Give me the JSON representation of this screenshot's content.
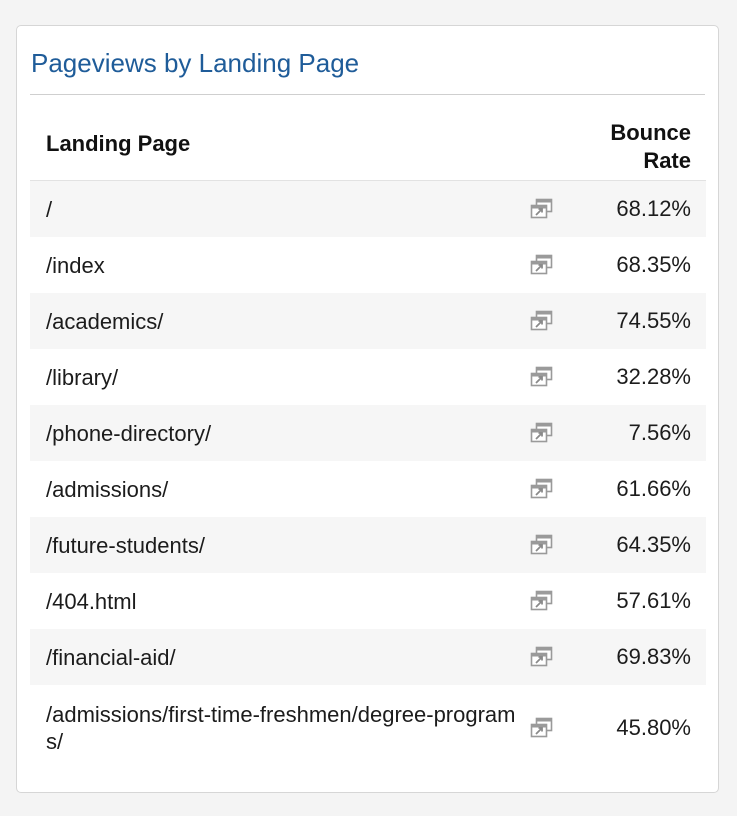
{
  "panel": {
    "title": "Pageviews by Landing Page"
  },
  "table": {
    "columns": {
      "landing_page": "Landing Page",
      "bounce_rate": "Bounce Rate"
    },
    "rows": [
      {
        "page": "/",
        "bounce_rate": "68.12%"
      },
      {
        "page": "/index",
        "bounce_rate": "68.35%"
      },
      {
        "page": "/academics/",
        "bounce_rate": "74.55%"
      },
      {
        "page": "/library/",
        "bounce_rate": "32.28%"
      },
      {
        "page": "/phone-directory/",
        "bounce_rate": "7.56%"
      },
      {
        "page": "/admissions/",
        "bounce_rate": "61.66%"
      },
      {
        "page": "/future-students/",
        "bounce_rate": "64.35%"
      },
      {
        "page": "/404.html",
        "bounce_rate": "57.61%"
      },
      {
        "page": "/financial-aid/",
        "bounce_rate": "69.83%"
      },
      {
        "page": "/admissions/first-time-freshmen/degree-programs/",
        "bounce_rate": "45.80%"
      }
    ],
    "row_link_icon": "open-in-new-window-icon"
  },
  "colors": {
    "title": "#1f5c99",
    "row_stripe": "#f6f6f6",
    "background": "#f4f4f4",
    "icon": "#9a9a9a"
  }
}
